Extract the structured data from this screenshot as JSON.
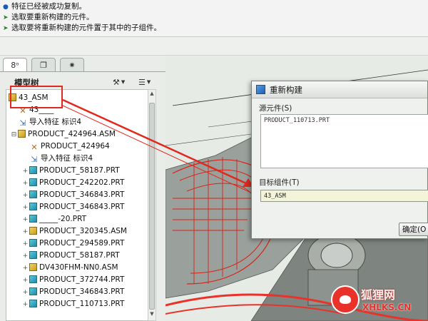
{
  "messages": [
    {
      "icon": "info-icon",
      "text": "特征已经被成功复制。"
    },
    {
      "icon": "arrow-right-icon",
      "text": "选取要重新构建的元件。"
    },
    {
      "icon": "arrow-right-icon",
      "text": "选取要将重新构建的元件置于其中的子组件。"
    }
  ],
  "model_tree": {
    "title": "模型树",
    "rows": [
      {
        "pm": "",
        "icon": "asm",
        "label": "43_ASM"
      },
      {
        "pm": "",
        "icon": "feat",
        "label": "43____"
      },
      {
        "pm": "",
        "icon": "imp",
        "label": "导入特征 标识4"
      },
      {
        "pm": "-",
        "icon": "asm",
        "label": "PRODUCT_424964.ASM"
      },
      {
        "pm": "",
        "icon": "feat",
        "label": "PRODUCT_424964"
      },
      {
        "pm": "",
        "icon": "imp",
        "label": "导入特征 标识4"
      },
      {
        "pm": "+",
        "icon": "part",
        "label": "PRODUCT_58187.PRT"
      },
      {
        "pm": "+",
        "icon": "part",
        "label": "PRODUCT_242202.PRT"
      },
      {
        "pm": "+",
        "icon": "part",
        "label": "PRODUCT_346843.PRT"
      },
      {
        "pm": "+",
        "icon": "part",
        "label": "PRODUCT_346843.PRT"
      },
      {
        "pm": "+",
        "icon": "part",
        "label": "_____-20.PRT"
      },
      {
        "pm": "+",
        "icon": "asm",
        "label": "PRODUCT_320345.ASM"
      },
      {
        "pm": "+",
        "icon": "part",
        "label": "PRODUCT_294589.PRT"
      },
      {
        "pm": "+",
        "icon": "part",
        "label": "PRODUCT_58187.PRT"
      },
      {
        "pm": "+",
        "icon": "asm",
        "label": "DV430FHM-NN0.ASM"
      },
      {
        "pm": "+",
        "icon": "part",
        "label": "PRODUCT_372744.PRT"
      },
      {
        "pm": "+",
        "icon": "part",
        "label": "PRODUCT_346843.PRT"
      },
      {
        "pm": "+",
        "icon": "part",
        "label": "PRODUCT_110713.PRT"
      }
    ]
  },
  "dialog": {
    "title": "重新构建",
    "source_label": "源元件(S)",
    "source_value": "PRODUCT_110713.PRT",
    "target_label": "目标组件(T)",
    "target_value": "43_ASM",
    "ok_label": "确定(O"
  },
  "watermark": {
    "text": "狐狸网",
    "url": "XHLKS.CN"
  }
}
